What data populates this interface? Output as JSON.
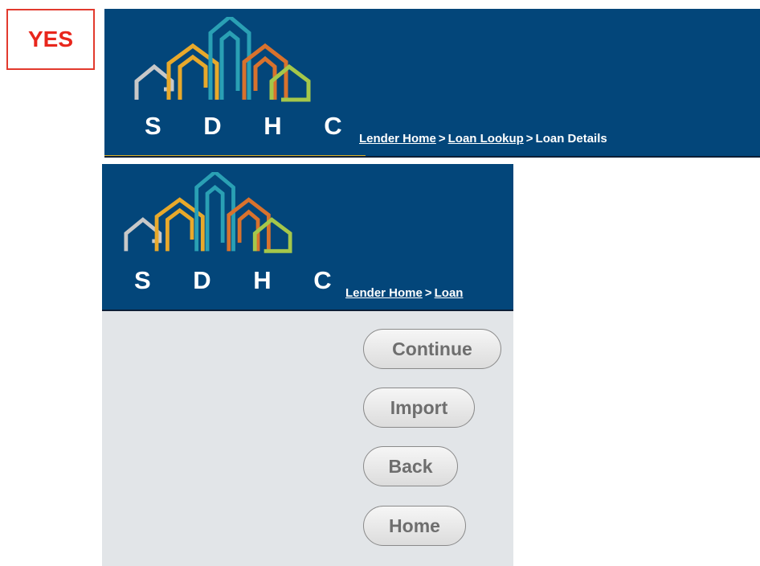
{
  "label": {
    "text": "YES",
    "color": "#e8261c"
  },
  "brand": {
    "logo_text": "S D H C",
    "banner_color": "#03467a"
  },
  "breadcrumb_top": {
    "home": "Lender Home",
    "sep1": ">",
    "lookup": "Loan Lookup",
    "sep2": ">",
    "current": "Loan Details"
  },
  "breadcrumb_bottom": {
    "home": "Lender Home",
    "sep1": ">",
    "lookup_partial": "Loan"
  },
  "buttons": {
    "continue": "Continue",
    "import": "Import",
    "back": "Back",
    "home": "Home"
  },
  "icons": [
    "sdhc-houses-logo"
  ]
}
